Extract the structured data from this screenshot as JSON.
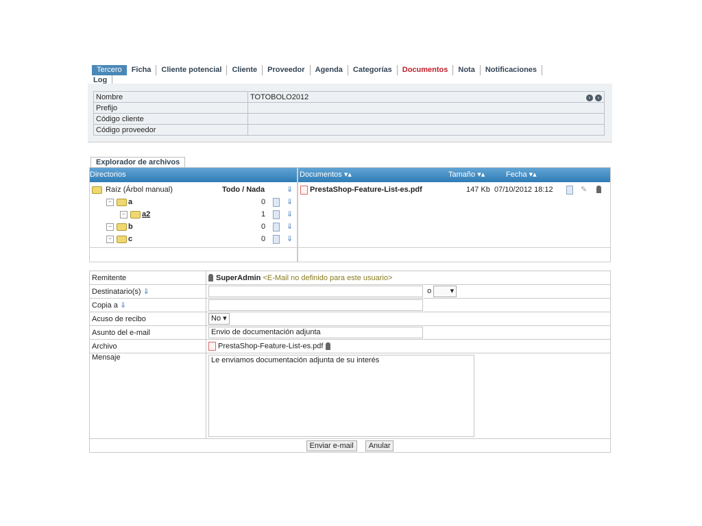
{
  "tabs": [
    "Tercero",
    "Ficha",
    "Cliente potencial",
    "Cliente",
    "Proveedor",
    "Agenda",
    "Categorías",
    "Documentos",
    "Nota",
    "Notificaciones",
    "Log"
  ],
  "info": {
    "rows": [
      {
        "label": "Nombre",
        "value": "TOTOBOLO2012"
      },
      {
        "label": "Prefijo",
        "value": ""
      },
      {
        "label": "Código cliente",
        "value": ""
      },
      {
        "label": "Código proveedor",
        "value": ""
      }
    ]
  },
  "explorer": {
    "tab": "Explorador de archivos",
    "dir_header": "Directorios",
    "root": "Raíz (Árbol manual)",
    "todo_nada": "Todo / Nada",
    "dirs": [
      {
        "name": "a",
        "count": "0"
      },
      {
        "name": "a2",
        "count": "1"
      },
      {
        "name": "b",
        "count": "0"
      },
      {
        "name": "c",
        "count": "0"
      }
    ],
    "doc_headers": {
      "documents": "Documentos",
      "size": "Tamaño",
      "date": "Fecha"
    },
    "files": [
      {
        "name": "PrestaShop-Feature-List-es.pdf",
        "size": "147 Kb",
        "date": "07/10/2012 18:12"
      }
    ]
  },
  "form": {
    "sender_label": "Remitente",
    "sender_name": "SuperAdmin",
    "sender_email": "<E-Mail no definido para este usuario>",
    "to_label": "Destinatario(s)",
    "or": "o",
    "cc_label": "Copia a",
    "receipt_label": "Acuso de recibo",
    "receipt_value": "No",
    "subject_label": "Asunto del e-mail",
    "subject_value": "Envio de documentación adjunta",
    "file_label": "Archivo",
    "file_value": "PrestaShop-Feature-List-es.pdf",
    "message_label": "Mensaje",
    "message_value": "Le enviamos documentación adjunta de su interés",
    "send": "Enviar e-mail",
    "cancel": "Anular"
  }
}
